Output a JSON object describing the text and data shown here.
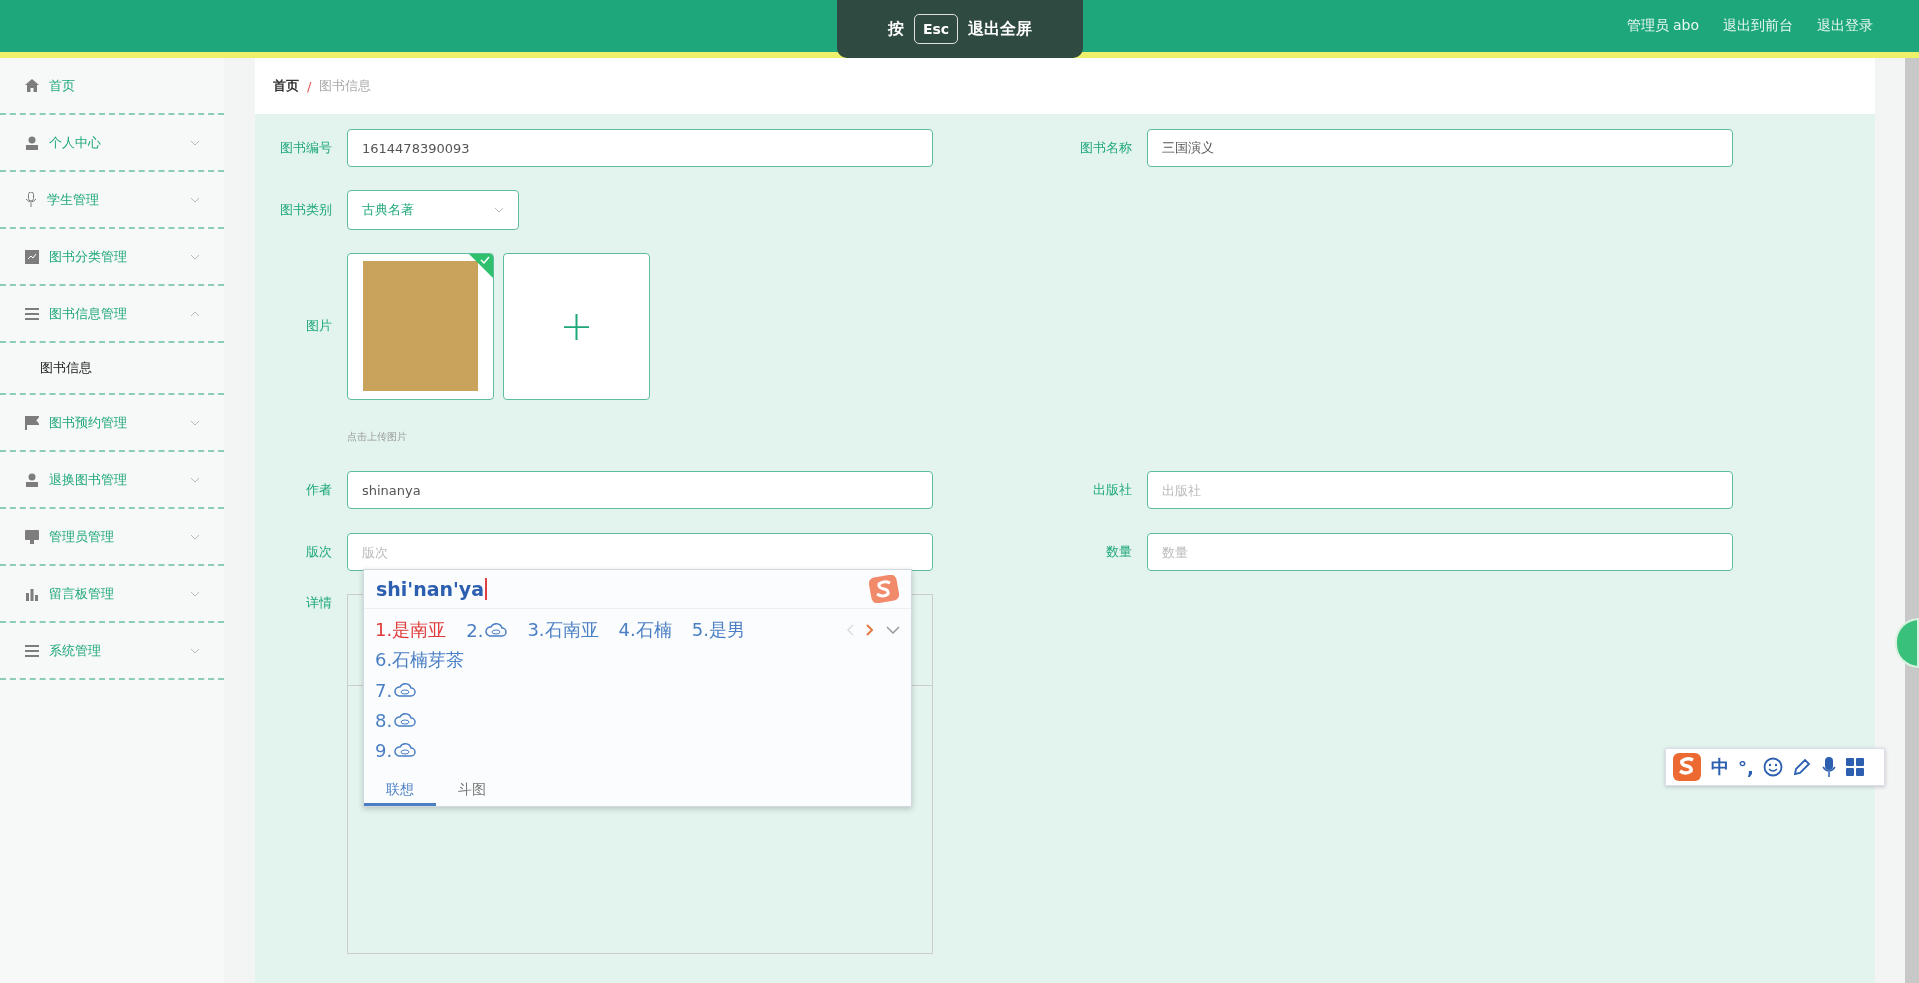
{
  "fullscreen_toast": {
    "prefix": "按",
    "key": "Esc",
    "suffix": "退出全屏"
  },
  "header": {
    "links": [
      "管理员 abo",
      "退出到前台",
      "退出登录"
    ]
  },
  "sidebar": {
    "items": [
      {
        "label": "首页",
        "kind": "home",
        "expandable": false
      },
      {
        "label": "个人中心",
        "kind": "user",
        "expandable": true,
        "expanded": false
      },
      {
        "label": "学生管理",
        "kind": "mic",
        "expandable": true,
        "expanded": false
      },
      {
        "label": "图书分类管理",
        "kind": "chart",
        "expandable": true,
        "expanded": false
      },
      {
        "label": "图书信息管理",
        "kind": "list",
        "expandable": true,
        "expanded": true,
        "children": [
          {
            "label": "图书信息"
          }
        ]
      },
      {
        "label": "图书预约管理",
        "kind": "flag",
        "expandable": true,
        "expanded": false
      },
      {
        "label": "退换图书管理",
        "kind": "user",
        "expandable": true,
        "expanded": false
      },
      {
        "label": "管理员管理",
        "kind": "monitor",
        "expandable": true,
        "expanded": false
      },
      {
        "label": "留言板管理",
        "kind": "bars",
        "expandable": true,
        "expanded": false
      },
      {
        "label": "系统管理",
        "kind": "list",
        "expandable": true,
        "expanded": false
      }
    ]
  },
  "breadcrumb": {
    "items": [
      "首页",
      "图书信息"
    ],
    "separator": "/"
  },
  "form": {
    "book_no": {
      "label": "图书编号",
      "value": "1614478390093"
    },
    "book_name": {
      "label": "图书名称",
      "value": "三国演义"
    },
    "category": {
      "label": "图书类别",
      "value": "古典名著"
    },
    "image": {
      "label": "图片",
      "hint": "点击上传图片",
      "add_symbol": "+"
    },
    "author": {
      "label": "作者",
      "value": "shinanya"
    },
    "publisher": {
      "label": "出版社",
      "placeholder": "出版社"
    },
    "edition": {
      "label": "版次",
      "placeholder": "版次"
    },
    "quantity": {
      "label": "数量",
      "placeholder": "数量"
    },
    "details": {
      "label": "详情"
    }
  },
  "ime_popup": {
    "composition": "shi'nan'ya",
    "candidates": [
      {
        "index": "1.",
        "text": "是南亚",
        "selected": true,
        "kind": "text"
      },
      {
        "index": "2.",
        "kind": "cloud",
        "selected": false
      },
      {
        "index": "3.",
        "text": "石南亚",
        "selected": false,
        "kind": "text"
      },
      {
        "index": "4.",
        "text": "石楠",
        "selected": false,
        "kind": "text"
      },
      {
        "index": "5.",
        "text": "是男",
        "selected": false,
        "kind": "text"
      },
      {
        "index": "6.",
        "text": "石楠芽茶",
        "selected": false,
        "kind": "text"
      },
      {
        "index": "7.",
        "kind": "cloud",
        "selected": false
      },
      {
        "index": "8.",
        "kind": "cloud",
        "selected": false
      },
      {
        "index": "9.",
        "kind": "cloud",
        "selected": false
      }
    ],
    "tabs": [
      {
        "label": "联想",
        "selected": true
      },
      {
        "label": "斗图",
        "selected": false
      }
    ]
  },
  "ime_toolbar": {
    "mode": "中",
    "punct": "°,"
  }
}
